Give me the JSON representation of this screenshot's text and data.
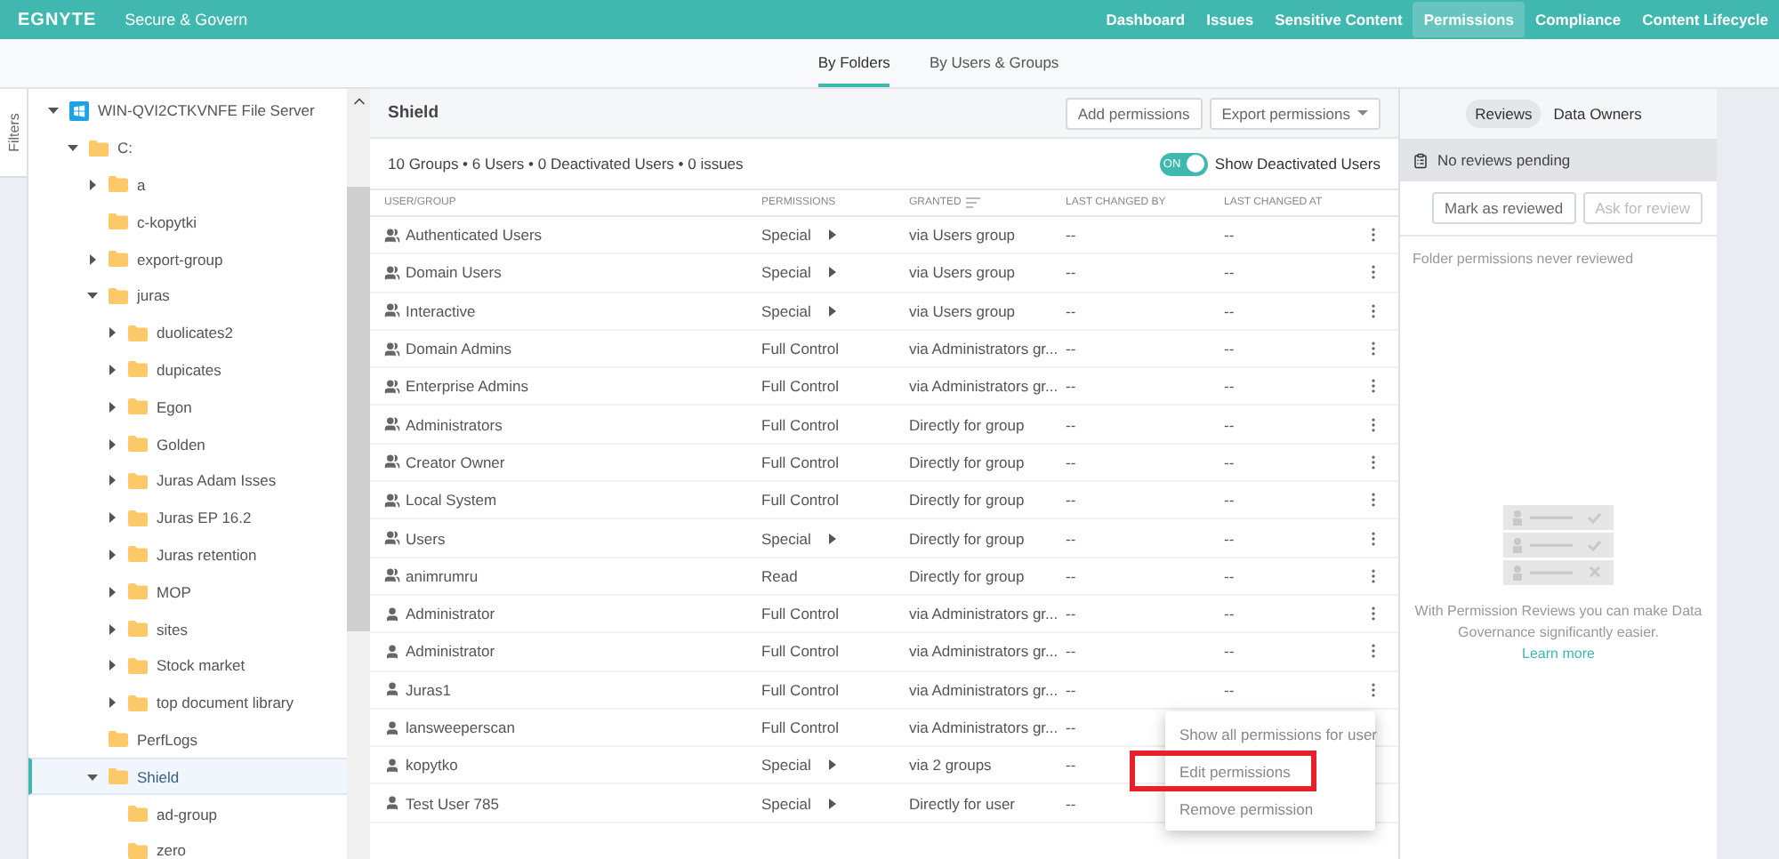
{
  "topbar": {
    "logo": "EGNYTE",
    "product": "Secure & Govern",
    "nav": [
      {
        "label": "Dashboard",
        "selected": false
      },
      {
        "label": "Issues",
        "selected": false
      },
      {
        "label": "Sensitive Content",
        "selected": false
      },
      {
        "label": "Permissions",
        "selected": true
      },
      {
        "label": "Compliance",
        "selected": false
      },
      {
        "label": "Content Lifecycle",
        "selected": false
      }
    ]
  },
  "subnav": [
    {
      "label": "By Folders",
      "selected": true
    },
    {
      "label": "By Users & Groups",
      "selected": false
    }
  ],
  "filters_label": "Filters",
  "tree": [
    {
      "label": "WIN-QVI2CTKVNFE File Server",
      "kind": "server",
      "has_children": true,
      "expanded": true,
      "selected": false,
      "children": [
        {
          "label": "C:",
          "kind": "folder",
          "has_children": true,
          "expanded": true,
          "selected": false,
          "children": [
            {
              "label": "a",
              "kind": "folder",
              "has_children": true,
              "expanded": false,
              "selected": false
            },
            {
              "label": "c-kopytki",
              "kind": "folder",
              "has_children": false,
              "expanded": false,
              "selected": false
            },
            {
              "label": "export-group",
              "kind": "folder",
              "has_children": true,
              "expanded": false,
              "selected": false
            },
            {
              "label": "juras",
              "kind": "folder",
              "has_children": true,
              "expanded": true,
              "selected": false,
              "children": [
                {
                  "label": "duolicates2",
                  "kind": "folder",
                  "has_children": true,
                  "expanded": false,
                  "selected": false
                },
                {
                  "label": "dupicates",
                  "kind": "folder",
                  "has_children": true,
                  "expanded": false,
                  "selected": false
                },
                {
                  "label": "Egon",
                  "kind": "folder",
                  "has_children": true,
                  "expanded": false,
                  "selected": false
                },
                {
                  "label": "Golden",
                  "kind": "folder",
                  "has_children": true,
                  "expanded": false,
                  "selected": false
                },
                {
                  "label": "Juras Adam Isses",
                  "kind": "folder",
                  "has_children": true,
                  "expanded": false,
                  "selected": false
                },
                {
                  "label": "Juras EP 16.2",
                  "kind": "folder",
                  "has_children": true,
                  "expanded": false,
                  "selected": false
                },
                {
                  "label": "Juras retention",
                  "kind": "folder",
                  "has_children": true,
                  "expanded": false,
                  "selected": false
                },
                {
                  "label": "MOP",
                  "kind": "folder",
                  "has_children": true,
                  "expanded": false,
                  "selected": false
                },
                {
                  "label": "sites",
                  "kind": "folder",
                  "has_children": true,
                  "expanded": false,
                  "selected": false
                },
                {
                  "label": "Stock market",
                  "kind": "folder",
                  "has_children": true,
                  "expanded": false,
                  "selected": false
                },
                {
                  "label": "top document library",
                  "kind": "folder",
                  "has_children": true,
                  "expanded": false,
                  "selected": false
                }
              ]
            },
            {
              "label": "PerfLogs",
              "kind": "folder",
              "has_children": false,
              "expanded": false,
              "selected": false
            },
            {
              "label": "Shield",
              "kind": "folder",
              "has_children": true,
              "expanded": true,
              "selected": true,
              "children": [
                {
                  "label": "ad-group",
                  "kind": "folder",
                  "has_children": false,
                  "expanded": false,
                  "selected": false
                },
                {
                  "label": "zero",
                  "kind": "folder",
                  "has_children": false,
                  "expanded": false,
                  "selected": false
                }
              ]
            }
          ]
        }
      ]
    }
  ],
  "table": {
    "title": "Shield",
    "actions": [
      "Add permissions",
      "Export permissions"
    ],
    "summary": "10 Groups • 6 Users • 0 Deactivated Users • 0 issues",
    "toggle": {
      "label": "Show Deactivated Users",
      "state_text": "ON",
      "on": true
    },
    "columns": [
      "USER/GROUP",
      "PERMISSIONS",
      "GRANTED",
      "LAST CHANGED BY",
      "LAST CHANGED AT"
    ],
    "rows": [
      {
        "kind": "group",
        "name": "Authenticated Users",
        "permission": "Special",
        "has_details": true,
        "granted": "via Users group",
        "changed_by": "--",
        "changed_at": "--"
      },
      {
        "kind": "group",
        "name": "Domain Users",
        "permission": "Special",
        "has_details": true,
        "granted": "via Users group",
        "changed_by": "--",
        "changed_at": "--"
      },
      {
        "kind": "group",
        "name": "Interactive",
        "permission": "Special",
        "has_details": true,
        "granted": "via Users group",
        "changed_by": "--",
        "changed_at": "--"
      },
      {
        "kind": "group",
        "name": "Domain Admins",
        "permission": "Full Control",
        "has_details": false,
        "granted": "via Administrators gr...",
        "changed_by": "--",
        "changed_at": "--"
      },
      {
        "kind": "group",
        "name": "Enterprise Admins",
        "permission": "Full Control",
        "has_details": false,
        "granted": "via Administrators gr...",
        "changed_by": "--",
        "changed_at": "--"
      },
      {
        "kind": "group",
        "name": "Administrators",
        "permission": "Full Control",
        "has_details": false,
        "granted": "Directly for group",
        "changed_by": "--",
        "changed_at": "--"
      },
      {
        "kind": "group",
        "name": "Creator Owner",
        "permission": "Full Control",
        "has_details": false,
        "granted": "Directly for group",
        "changed_by": "--",
        "changed_at": "--"
      },
      {
        "kind": "group",
        "name": "Local System",
        "permission": "Full Control",
        "has_details": false,
        "granted": "Directly for group",
        "changed_by": "--",
        "changed_at": "--"
      },
      {
        "kind": "group",
        "name": "Users",
        "permission": "Special",
        "has_details": true,
        "granted": "Directly for group",
        "changed_by": "--",
        "changed_at": "--"
      },
      {
        "kind": "group",
        "name": "animrumru",
        "permission": "Read",
        "has_details": false,
        "granted": "Directly for group",
        "changed_by": "--",
        "changed_at": "--"
      },
      {
        "kind": "user",
        "name": "Administrator",
        "permission": "Full Control",
        "has_details": false,
        "granted": "via Administrators gr...",
        "changed_by": "--",
        "changed_at": "--"
      },
      {
        "kind": "user",
        "name": "Administrator",
        "permission": "Full Control",
        "has_details": false,
        "granted": "via Administrators gr...",
        "changed_by": "--",
        "changed_at": "--"
      },
      {
        "kind": "user",
        "name": "Juras1",
        "permission": "Full Control",
        "has_details": false,
        "granted": "via Administrators gr...",
        "changed_by": "--",
        "changed_at": "--"
      },
      {
        "kind": "user",
        "name": "lansweeperscan",
        "permission": "Full Control",
        "has_details": false,
        "granted": "via Administrators gr...",
        "changed_by": "--"
      },
      {
        "kind": "user",
        "name": "kopytko",
        "permission": "Special",
        "has_details": true,
        "granted": "via 2 groups",
        "changed_by": "--"
      },
      {
        "kind": "user",
        "name": "Test User 785",
        "permission": "Special",
        "has_details": true,
        "granted": "Directly for user",
        "changed_by": "--"
      }
    ],
    "menu": [
      {
        "label": "Show all permissions for user",
        "highlighted": false
      },
      {
        "label": "Edit permissions",
        "highlighted": true
      },
      {
        "label": "Remove permission",
        "highlighted": false
      }
    ]
  },
  "reviews": {
    "tabs": [
      {
        "label": "Reviews",
        "selected": true
      },
      {
        "label": "Data Owners",
        "selected": false
      }
    ],
    "status": "No reviews pending",
    "buttons": [
      {
        "label": "Mark as reviewed",
        "disabled": false
      },
      {
        "label": "Ask for review",
        "disabled": true
      }
    ],
    "note": "Folder permissions never reviewed",
    "empty_text": "With Permission Reviews you can make Data Governance significantly easier.",
    "link": "Learn more"
  }
}
